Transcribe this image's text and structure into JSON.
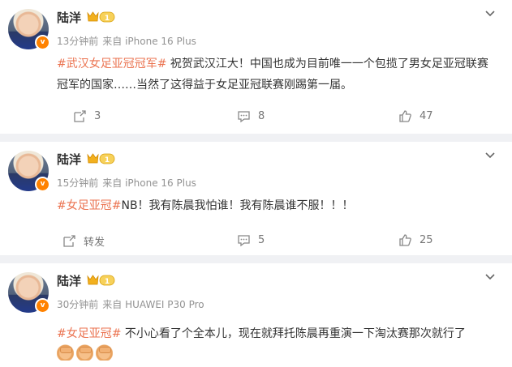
{
  "posts": [
    {
      "author": "陆洋",
      "level": "1",
      "time": "13分钟前",
      "source": "来自 iPhone 16 Plus",
      "topic": "#武汉女足亚冠冠军#",
      "text": " 祝贺武汉江大！中国也成为目前唯一一个包揽了男女足亚冠联赛冠军的国家……当然了这得益于女足亚冠联赛刚踢第一届。",
      "repost": "3",
      "comments": "8",
      "likes": "47"
    },
    {
      "author": "陆洋",
      "level": "1",
      "time": "15分钟前",
      "source": "来自 iPhone 16 Plus",
      "topic": "#女足亚冠#",
      "text": "NB！我有陈晨我怕谁！我有陈晨谁不服！！！",
      "repost": "转发",
      "comments": "5",
      "likes": "25"
    },
    {
      "author": "陆洋",
      "level": "1",
      "time": "30分钟前",
      "source": "来自 HUAWEI P30 Pro",
      "topic": "#女足亚冠#",
      "text": " 不小心看了个全本儿，现在就拜托陈晨再重演一下淘汰赛那次就行了",
      "emojis": [
        "clap-emoji",
        "clap-emoji",
        "clap-emoji"
      ]
    }
  ],
  "icons": {
    "repost": "repost-icon",
    "comment": "comment-icon",
    "like": "like-icon",
    "more": "chevron-down-icon",
    "verified": "verified-badge-icon"
  },
  "colors": {
    "topic": "#eb7350",
    "badge": "#ff8200",
    "separator": "#f0f1f4"
  }
}
